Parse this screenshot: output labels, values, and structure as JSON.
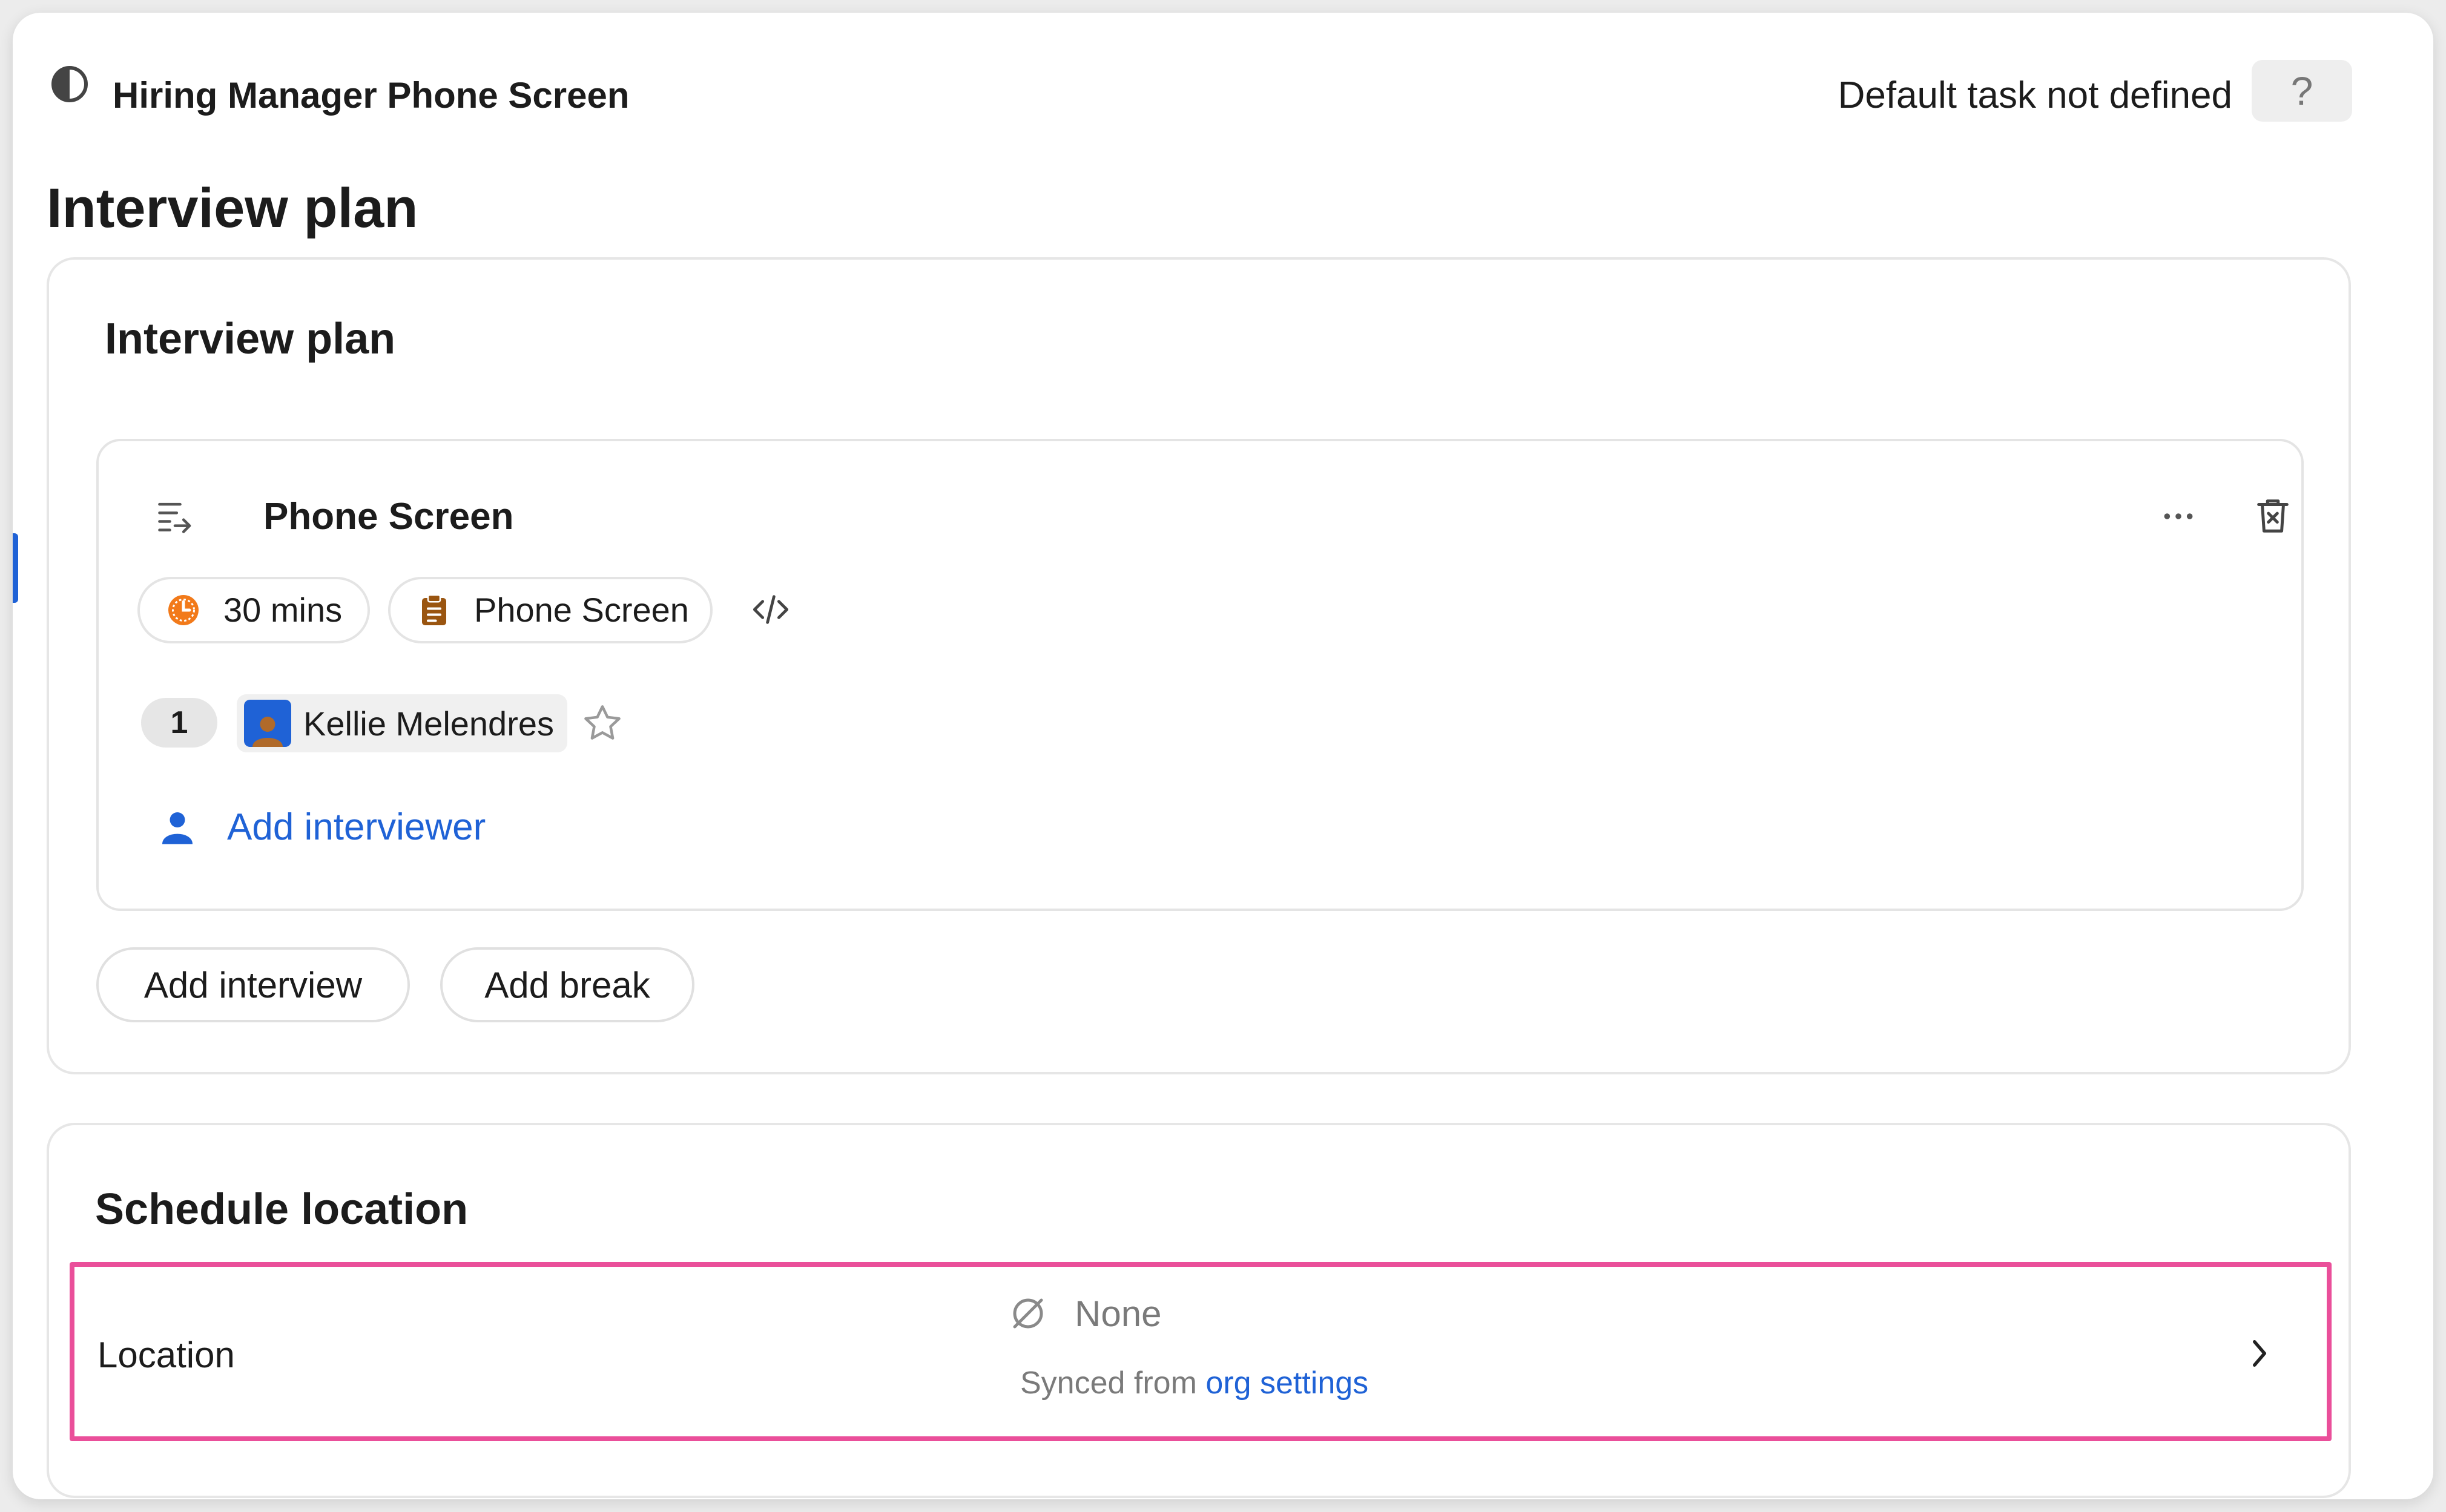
{
  "header": {
    "icon": "half-circle-icon",
    "title": "Hiring Manager Phone Screen",
    "default_task_status": "Default task not defined",
    "help_label": "?"
  },
  "page": {
    "title": "Interview plan"
  },
  "plan_card": {
    "title": "Interview plan",
    "interview": {
      "title": "Phone Screen",
      "duration": "30 mins",
      "interview_kit": "Phone Screen",
      "interviewer_count": "1",
      "interviewers": [
        {
          "name": "Kellie Melendres"
        }
      ],
      "add_interviewer_label": "Add interviewer"
    },
    "buttons": {
      "add_interview": "Add interview",
      "add_break": "Add break"
    }
  },
  "location_card": {
    "title": "Schedule location",
    "row": {
      "label": "Location",
      "value": "None",
      "synced_prefix": "Synced from ",
      "synced_link": "org settings"
    }
  },
  "colors": {
    "accent_blue": "#1f62d6",
    "highlight_pink": "#ea4f9a",
    "clock_orange": "#f27a1a",
    "clipboard_brown": "#9a5510"
  }
}
